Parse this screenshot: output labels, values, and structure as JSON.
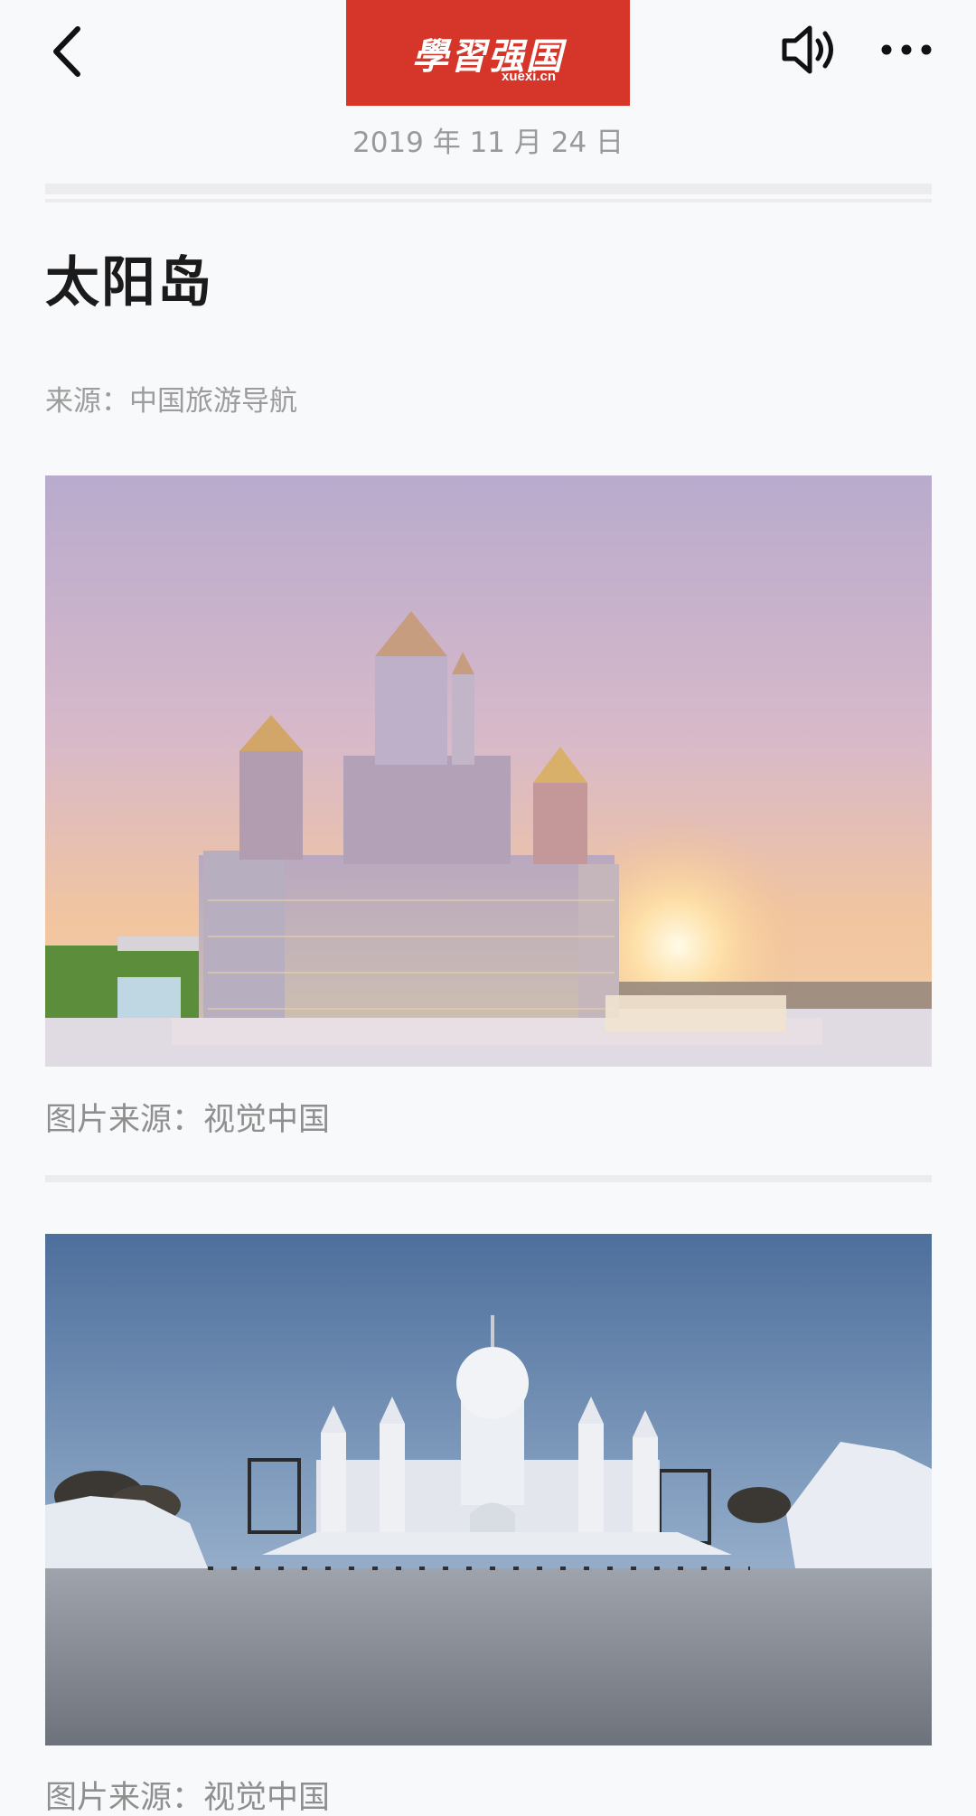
{
  "header": {
    "logo_text": "學習强国",
    "logo_sub": "xuexi.cn",
    "back_icon": "chevron-left-icon",
    "speaker_icon": "speaker-icon",
    "more_icon": "more-dots-icon",
    "brand_color": "#d6362a"
  },
  "article": {
    "date": "2019 年 11 月 24 日",
    "title": "太阳岛",
    "source": "来源：中国旅游导航"
  },
  "images": [
    {
      "caption": "图片来源：视觉中国"
    },
    {
      "caption": "图片来源：视觉中国"
    }
  ]
}
